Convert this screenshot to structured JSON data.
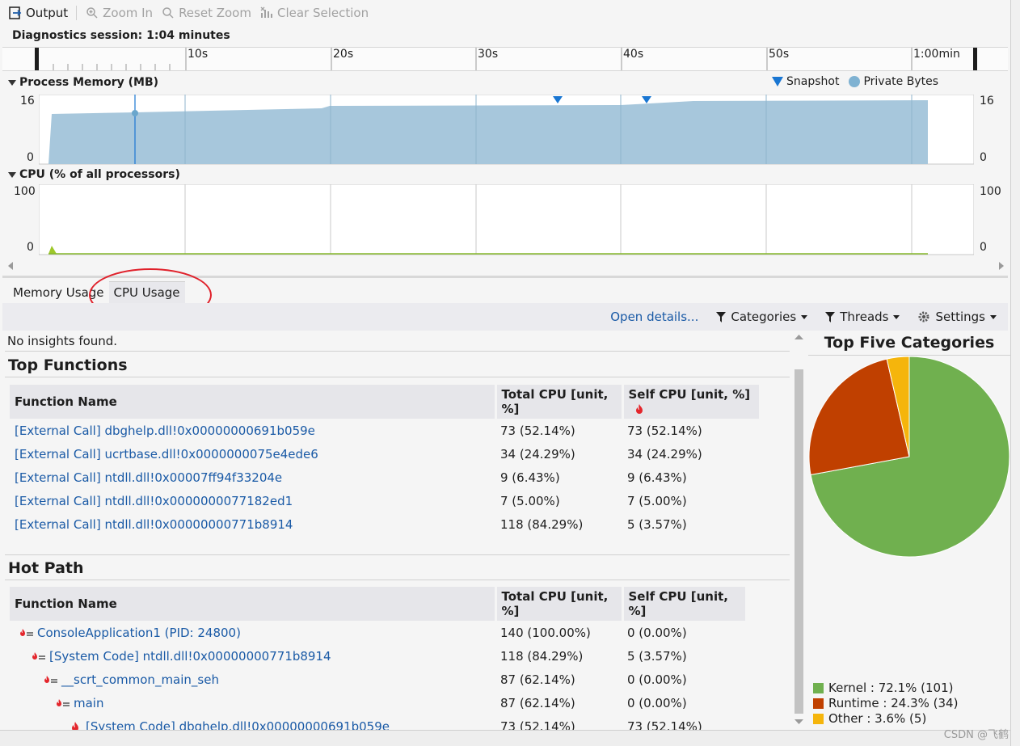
{
  "toolbar": {
    "output": "Output",
    "zoom_in": "Zoom In",
    "reset_zoom": "Reset Zoom",
    "clear_selection": "Clear Selection"
  },
  "session": {
    "label": "Diagnostics session: 1:04 minutes"
  },
  "ruler": {
    "ticks": [
      "10s",
      "20s",
      "30s",
      "40s",
      "50s",
      "1:00min"
    ]
  },
  "memory_graph": {
    "title": "Process Memory (MB)",
    "y_max": "16",
    "y_min": "0",
    "legend_snapshot": "Snapshot",
    "legend_private": "Private Bytes",
    "colors": {
      "fill": "#a7c7dc",
      "snapshot": "#1976d2",
      "private": "#7fb2d2"
    }
  },
  "cpu_graph": {
    "title": "CPU (% of all processors)",
    "y_max": "100",
    "y_min": "0",
    "colors": {
      "line": "#86b82a"
    }
  },
  "tabs": [
    {
      "label": "Memory Usage"
    },
    {
      "label": "CPU Usage"
    }
  ],
  "cmdbar": {
    "open_details": "Open details...",
    "categories": "Categories",
    "threads": "Threads",
    "settings": "Settings"
  },
  "insights": "No insights found.",
  "top_functions": {
    "title": "Top Functions",
    "headers": [
      "Function Name",
      "Total CPU [unit, %]",
      "Self CPU [unit, %]"
    ],
    "rows": [
      {
        "name": "[External Call] dbghelp.dll!0x00000000691b059e",
        "total": "73 (52.14%)",
        "self": "73 (52.14%)"
      },
      {
        "name": "[External Call] ucrtbase.dll!0x0000000075e4ede6",
        "total": "34 (24.29%)",
        "self": "34 (24.29%)"
      },
      {
        "name": "[External Call] ntdll.dll!0x00007ff94f33204e",
        "total": "9 (6.43%)",
        "self": "9 (6.43%)"
      },
      {
        "name": "[External Call] ntdll.dll!0x0000000077182ed1",
        "total": "7 (5.00%)",
        "self": "7 (5.00%)"
      },
      {
        "name": "[External Call] ntdll.dll!0x00000000771b8914",
        "total": "118 (84.29%)",
        "self": "5 (3.57%)"
      }
    ]
  },
  "hot_path": {
    "title": "Hot Path",
    "headers": [
      "Function Name",
      "Total CPU [unit, %]",
      "Self CPU [unit, %]"
    ],
    "rows": [
      {
        "name": "ConsoleApplication1 (PID: 24800)",
        "total": "140 (100.00%)",
        "self": "0 (0.00%)",
        "depth": 0,
        "icon": "hot-path-icon"
      },
      {
        "name": "[System Code] ntdll.dll!0x00000000771b8914",
        "total": "118 (84.29%)",
        "self": "5 (3.57%)",
        "depth": 1,
        "icon": "hot-path-icon"
      },
      {
        "name": "__scrt_common_main_seh",
        "total": "87 (62.14%)",
        "self": "0 (0.00%)",
        "depth": 2,
        "icon": "hot-path-icon"
      },
      {
        "name": "main",
        "total": "87 (62.14%)",
        "self": "0 (0.00%)",
        "depth": 3,
        "icon": "hot-path-icon"
      },
      {
        "name": "[System Code] dbghelp.dll!0x00000000691b059e",
        "total": "73 (52.14%)",
        "self": "73 (52.14%)",
        "depth": 4,
        "icon": "flame-icon"
      }
    ]
  },
  "top_five": {
    "title": "Top Five Categories",
    "chart_data": {
      "type": "pie",
      "categories": [
        "Kernel",
        "Runtime",
        "Other"
      ],
      "values": [
        72.1,
        24.3,
        3.6
      ],
      "counts": [
        101,
        34,
        5
      ],
      "colors": [
        "#70b04f",
        "#c04000",
        "#f5b50c"
      ]
    },
    "legend": [
      "Kernel : 72.1% (101)",
      "Runtime : 24.3% (34)",
      "Other : 3.6% (5)"
    ]
  },
  "watermark": "CSDN @飞鹤"
}
